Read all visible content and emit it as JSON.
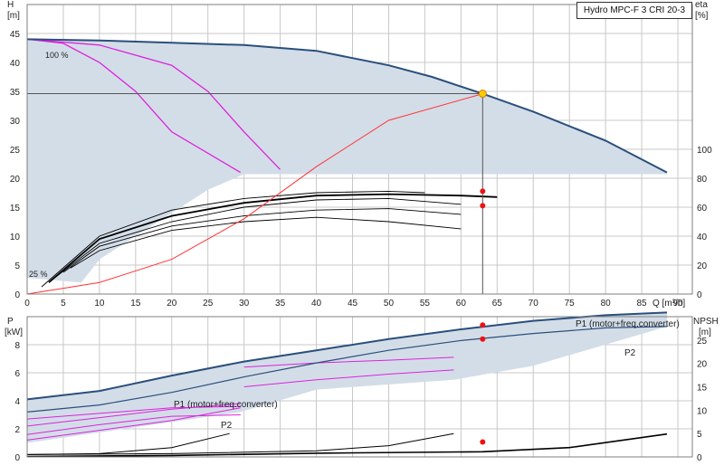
{
  "title": "Hydro MPC-F 3 CRI 20-3",
  "colors": {
    "grid": "#c8c8c8",
    "frame": "#7f7f7f",
    "area": "#d3dde8",
    "qh_curve": "#2a4f7c",
    "partial_speed": "#dd22dd",
    "efficiency": "#000000",
    "system": "#ff3333",
    "duty_point": "#ffcc00",
    "duty_marker": "#ee1111",
    "power_label": "#1f4f8f"
  },
  "chart_data": [
    {
      "type": "line",
      "name": "head-efficiency",
      "xlabel": "Q [m³/h]",
      "ylabel_left": "H",
      "ylabel_left_unit": "[m]",
      "ylabel_right": "eta",
      "ylabel_right_unit": "[%]",
      "xlim": [
        0,
        92
      ],
      "ylim_left": [
        0,
        50
      ],
      "ylim_right": [
        0,
        200
      ],
      "x_ticks": [
        0,
        5,
        10,
        15,
        20,
        25,
        30,
        35,
        40,
        45,
        50,
        55,
        60,
        65,
        70,
        75,
        80,
        85,
        90
      ],
      "y_ticks_left": [
        0,
        5,
        10,
        15,
        20,
        25,
        30,
        35,
        40,
        45
      ],
      "y_ticks_right": [
        0,
        20,
        40,
        60,
        80,
        100
      ],
      "grid": true,
      "speed_label": "100 %",
      "min_label": "25 %",
      "qh_envelope": [
        [
          0,
          44
        ],
        [
          10,
          43.8
        ],
        [
          20,
          43.4
        ],
        [
          30,
          43
        ],
        [
          40,
          42
        ],
        [
          50,
          39.5
        ],
        [
          56,
          37.5
        ],
        [
          63,
          34.6
        ],
        [
          70,
          31.5
        ],
        [
          80,
          26.5
        ],
        [
          88.5,
          21
        ]
      ],
      "partial_speed_curves": [
        [
          [
            0,
            44
          ],
          [
            10,
            43
          ],
          [
            20,
            39.5
          ],
          [
            25,
            35
          ],
          [
            30,
            28
          ],
          [
            35,
            21.5
          ]
        ],
        [
          [
            0,
            44
          ],
          [
            5,
            43.3
          ],
          [
            10,
            40
          ],
          [
            15,
            35
          ],
          [
            20,
            28
          ],
          [
            29.5,
            21
          ]
        ],
        [
          [
            29.5,
            21
          ],
          [
            40,
            20.8
          ],
          [
            50,
            20.7
          ],
          [
            60,
            20.7
          ],
          [
            70,
            20.7
          ],
          [
            80,
            20.7
          ],
          [
            88.5,
            20.7
          ]
        ]
      ],
      "eta_curves": [
        [
          [
            2,
            5
          ],
          [
            10,
            40
          ],
          [
            20,
            58
          ],
          [
            30,
            66
          ],
          [
            40,
            70
          ],
          [
            50,
            71
          ],
          [
            55,
            70
          ]
        ],
        [
          [
            3,
            8
          ],
          [
            10,
            38
          ],
          [
            20,
            54
          ],
          [
            30,
            63
          ],
          [
            40,
            68
          ],
          [
            50,
            69
          ],
          [
            60,
            68
          ],
          [
            65,
            67
          ]
        ],
        [
          [
            4,
            12
          ],
          [
            10,
            35
          ],
          [
            20,
            50
          ],
          [
            30,
            60
          ],
          [
            40,
            65
          ],
          [
            50,
            66
          ],
          [
            60,
            62
          ]
        ],
        [
          [
            5,
            15
          ],
          [
            10,
            33
          ],
          [
            20,
            47
          ],
          [
            30,
            54
          ],
          [
            40,
            58
          ],
          [
            50,
            59
          ],
          [
            60,
            55
          ]
        ],
        [
          [
            6,
            18
          ],
          [
            10,
            30
          ],
          [
            20,
            44
          ],
          [
            30,
            50
          ],
          [
            40,
            53
          ],
          [
            50,
            50
          ],
          [
            60,
            45
          ]
        ]
      ],
      "system_curve": [
        [
          0,
          0
        ],
        [
          10,
          2
        ],
        [
          20,
          6
        ],
        [
          30,
          13
        ],
        [
          40,
          22
        ],
        [
          50,
          30
        ],
        [
          63,
          34.6
        ]
      ],
      "duty_point": {
        "q": 63,
        "h": 34.6,
        "eta_markers": [
          71,
          61
        ]
      }
    },
    {
      "type": "line",
      "name": "power-npsh",
      "ylabel_left": "P",
      "ylabel_left_unit": "[kW]",
      "ylabel_right": "NPSH",
      "ylabel_right_unit": "[m]",
      "xlim": [
        0,
        92
      ],
      "ylim_left": [
        0,
        10
      ],
      "ylim_right": [
        0,
        30
      ],
      "y_ticks_left": [
        0,
        2,
        4,
        6,
        8
      ],
      "y_ticks_right": [
        0,
        5,
        10,
        15,
        20,
        25
      ],
      "grid": true,
      "p1_label": "P1 (motor+freq.converter)",
      "p2_label": "P2",
      "p1_label_mid": "P1 (motor+freq.converter)",
      "p2_label_mid": "P2",
      "power_p1": [
        [
          0,
          4.1
        ],
        [
          10,
          4.7
        ],
        [
          20,
          5.8
        ],
        [
          30,
          6.8
        ],
        [
          40,
          7.6
        ],
        [
          50,
          8.4
        ],
        [
          60,
          9.1
        ],
        [
          70,
          9.7
        ],
        [
          80,
          10.1
        ],
        [
          88.5,
          10.3
        ]
      ],
      "power_p2": [
        [
          0,
          3.2
        ],
        [
          10,
          3.7
        ],
        [
          20,
          4.6
        ],
        [
          30,
          5.7
        ],
        [
          40,
          6.7
        ],
        [
          50,
          7.6
        ],
        [
          60,
          8.3
        ],
        [
          70,
          8.8
        ],
        [
          80,
          9.2
        ],
        [
          88.5,
          9.3
        ]
      ],
      "partial_power": [
        [
          [
            0,
            2.7
          ],
          [
            10,
            3.1
          ],
          [
            20,
            3.5
          ],
          [
            29.5,
            3.6
          ]
        ],
        [
          [
            0,
            2.2
          ],
          [
            10,
            2.8
          ],
          [
            20,
            3.4
          ],
          [
            29.5,
            3.8
          ]
        ],
        [
          [
            0,
            1.6
          ],
          [
            10,
            2.3
          ],
          [
            20,
            2.9
          ],
          [
            29.5,
            3.0
          ]
        ],
        [
          [
            0,
            1.2
          ],
          [
            10,
            1.9
          ],
          [
            20,
            2.6
          ],
          [
            29.5,
            3.5
          ]
        ],
        [
          [
            30,
            6.4
          ],
          [
            40,
            6.7
          ],
          [
            50,
            6.9
          ],
          [
            59,
            7.1
          ]
        ],
        [
          [
            30,
            5.0
          ],
          [
            40,
            5.5
          ],
          [
            50,
            5.9
          ],
          [
            59,
            6.2
          ]
        ]
      ],
      "npsh_curves": [
        [
          [
            0,
            0.5
          ],
          [
            10,
            0.7
          ],
          [
            20,
            2
          ],
          [
            28,
            5
          ]
        ],
        [
          [
            0,
            0.5
          ],
          [
            20,
            0.7
          ],
          [
            40,
            1.3
          ],
          [
            50,
            2.4
          ],
          [
            59,
            5
          ]
        ],
        [
          [
            0,
            0.1
          ],
          [
            20,
            0.3
          ],
          [
            40,
            0.8
          ],
          [
            63,
            1.1
          ],
          [
            75,
            2
          ],
          [
            88.5,
            4.9
          ]
        ]
      ],
      "duty_markers": [
        {
          "q": 63,
          "p": 9.4
        },
        {
          "q": 63,
          "p": 8.4
        },
        {
          "q": 63,
          "npsh": 3.2
        }
      ]
    }
  ]
}
